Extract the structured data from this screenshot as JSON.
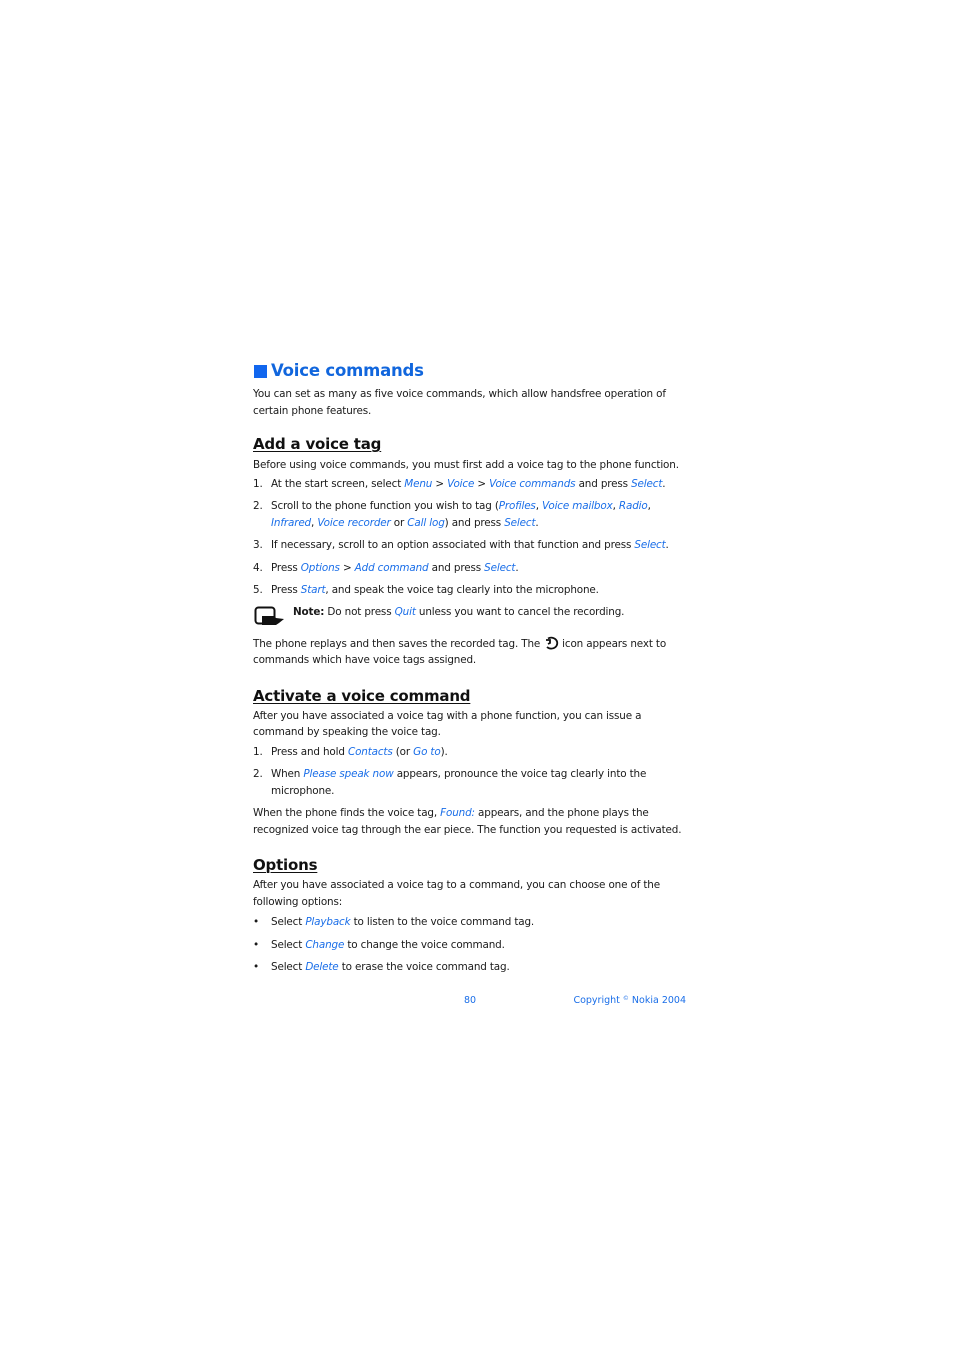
{
  "title": "Voice commands",
  "intro": "You can set as many as five voice commands, which allow handsfree operation of certain phone features.",
  "sections": {
    "add_tag": {
      "heading": "Add a voice tag",
      "lead": "Before using voice commands, you must first add a voice tag to the phone function.",
      "steps": {
        "s1": {
          "num": "1.",
          "t1": "At the start screen, select ",
          "k1": "Menu",
          "t2": " > ",
          "k2": "Voice",
          "t3": " > ",
          "k3": "Voice commands",
          "t4": " and press ",
          "k4": "Select",
          "t5": "."
        },
        "s2": {
          "num": "2.",
          "t1": "Scroll to the phone function you wish to tag (",
          "k1": "Profiles",
          "t2": ", ",
          "k2": "Voice mailbox",
          "t3": ", ",
          "k3": "Radio",
          "t4": ", ",
          "k4": "Infrared",
          "t5": ", ",
          "k5": "Voice recorder",
          "t6": " or ",
          "k6": "Call log",
          "t7": ") and press ",
          "k7": "Select",
          "t8": "."
        },
        "s3": {
          "num": "3.",
          "t1": "If necessary, scroll to an option associated with that function and press ",
          "k1": "Select",
          "t2": "."
        },
        "s4": {
          "num": "4.",
          "t1": "Press ",
          "k1": "Options",
          "t2": " > ",
          "k2": "Add command",
          "t3": " and press ",
          "k3": "Select",
          "t4": "."
        },
        "s5": {
          "num": "5.",
          "t1": "Press ",
          "k1": "Start",
          "t2": ", and speak the voice tag clearly into the microphone."
        }
      },
      "note": {
        "label": "Note:",
        "t1": " Do not press ",
        "k1": "Quit",
        "t2": " unless you want to cancel the recording.",
        "icon": "note-hand-icon"
      },
      "after_a": "The phone replays and then saves the recorded tag. The",
      "after_icon": "voice-tag-icon",
      "after_b": "icon appears next to commands which have voice tags assigned."
    },
    "activate": {
      "heading": "Activate a voice command",
      "lead": "After you have associated a voice tag with a phone function, you can issue a command by speaking the voice tag.",
      "steps": {
        "s1": {
          "num": "1.",
          "t1": "Press and hold ",
          "k1": "Contacts",
          "t2": " (or ",
          "k2": "Go to",
          "t3": ")."
        },
        "s2": {
          "num": "2.",
          "t1": "When ",
          "k1": "Please speak now",
          "t2": " appears, pronounce the voice tag clearly into the microphone."
        }
      },
      "outro": {
        "t1": "When the phone finds the voice tag, ",
        "k1": "Found:",
        "t2": " appears, and the phone plays the recognized voice tag through the ear piece. The function you requested is activated."
      }
    },
    "options": {
      "heading": "Options",
      "lead": "After you have associated a voice tag to a command, you can choose one of the following options:",
      "bullets": {
        "b1": {
          "bullet": "•",
          "t1": "Select ",
          "k1": "Playback",
          "t2": " to listen to the voice command tag."
        },
        "b2": {
          "bullet": "•",
          "t1": "Select ",
          "k1": "Change",
          "t2": " to change the voice command."
        },
        "b3": {
          "bullet": "•",
          "t1": "Select ",
          "k1": "Delete",
          "t2": " to erase the voice command tag."
        }
      }
    }
  },
  "footer": {
    "page_number": "80",
    "copyright": "Copyright",
    "copyright_symbol": "©",
    "copyright_holder": "Nokia 2004"
  },
  "colors": {
    "accent": "#1a6ee8",
    "heading_blue": "#1166dd",
    "text": "#1a1a1a"
  }
}
